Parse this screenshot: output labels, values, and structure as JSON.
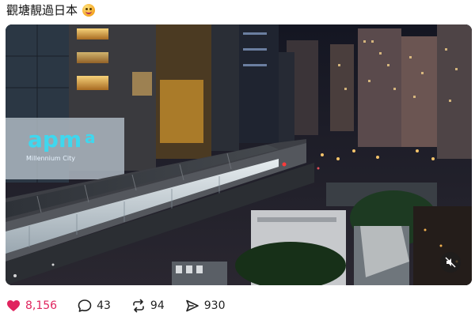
{
  "post": {
    "caption": "觀塘靚過日本",
    "emoji": "smiling-face-icon"
  },
  "media": {
    "sign_text": "apm",
    "sign_subtext": "Millennium City",
    "mute_icon": "muted-speaker-icon"
  },
  "actions": {
    "likes": "8,156",
    "comments": "43",
    "reposts": "94",
    "shares": "930",
    "like_color": "#e0245e"
  }
}
